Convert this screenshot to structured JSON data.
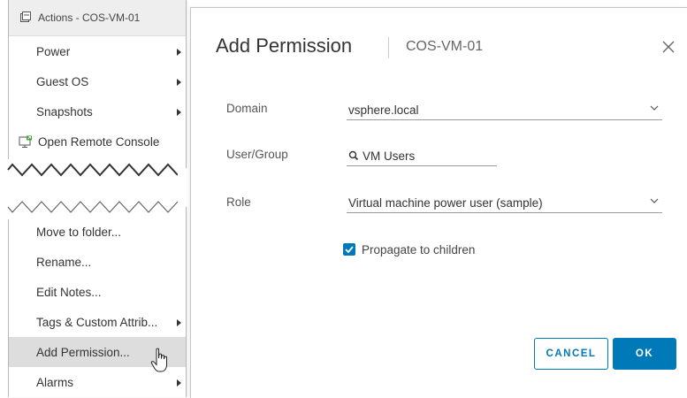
{
  "menu": {
    "header": "Actions - COS-VM-01",
    "top_items": [
      {
        "label": "Power",
        "submenu": true
      },
      {
        "label": "Guest OS",
        "submenu": true
      },
      {
        "label": "Snapshots",
        "submenu": true
      },
      {
        "label": "Open Remote Console",
        "submenu": false
      }
    ],
    "bottom_items": [
      {
        "label": "Move to folder...",
        "submenu": false
      },
      {
        "label": "Rename...",
        "submenu": false
      },
      {
        "label": "Edit Notes...",
        "submenu": false
      },
      {
        "label": "Tags & Custom Attrib...",
        "submenu": true
      },
      {
        "label": "Add Permission...",
        "submenu": false,
        "highlighted": true
      },
      {
        "label": "Alarms",
        "submenu": true
      }
    ]
  },
  "dialog": {
    "title": "Add Permission",
    "subtitle": "COS-VM-01",
    "domain": {
      "label": "Domain",
      "value": "vsphere.local"
    },
    "user_group": {
      "label": "User/Group",
      "value": "VM Users"
    },
    "role": {
      "label": "Role",
      "value": "Virtual machine power user (sample)"
    },
    "propagate": {
      "label": "Propagate to children",
      "checked": true
    },
    "cancel_label": "CANCEL",
    "ok_label": "OK"
  },
  "colors": {
    "accent": "#0079b8",
    "menu_header_bg": "#eeeeee",
    "highlight_bg": "#dddddd"
  }
}
